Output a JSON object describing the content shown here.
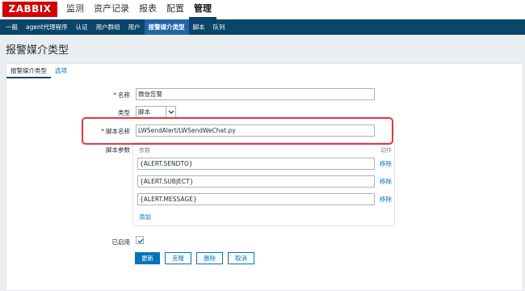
{
  "logo": "ZABBIX",
  "main_nav": [
    {
      "label": "监测"
    },
    {
      "label": "资产记录"
    },
    {
      "label": "报表"
    },
    {
      "label": "配置"
    },
    {
      "label": "管理"
    }
  ],
  "sub_nav": [
    {
      "label": "一般"
    },
    {
      "label": "agent代理程序"
    },
    {
      "label": "认证"
    },
    {
      "label": "用户群组"
    },
    {
      "label": "用户"
    },
    {
      "label": "报警媒介类型"
    },
    {
      "label": "脚本"
    },
    {
      "label": "队列"
    }
  ],
  "page_title": "报警媒介类型",
  "tabs": [
    {
      "label": "报警媒介类型"
    },
    {
      "label": "选项"
    }
  ],
  "form": {
    "name_label": "名称",
    "name_value": "微信告警",
    "type_label": "类型",
    "type_value": "脚本",
    "script_label": "脚本名称",
    "script_value": "LWSendAlert/LWSendWeChat.py",
    "params_label": "脚本参数",
    "params_col_param": "参数",
    "params_col_action": "动作",
    "params": [
      {
        "value": "{ALERT.SENDTO}",
        "remove": "移除"
      },
      {
        "value": "{ALERT.SUBJECT}",
        "remove": "移除"
      },
      {
        "value": "{ALERT.MESSAGE}",
        "remove": "移除"
      }
    ],
    "add_label": "添加",
    "enabled_label": "已启用",
    "enabled": true
  },
  "buttons": {
    "update": "更新",
    "clone": "克隆",
    "delete": "删除",
    "cancel": "取消"
  },
  "colors": {
    "logo_bg": "#d40000",
    "nav_bg": "#0a466a",
    "accent": "#0275b8",
    "highlight": "#e8343e"
  }
}
